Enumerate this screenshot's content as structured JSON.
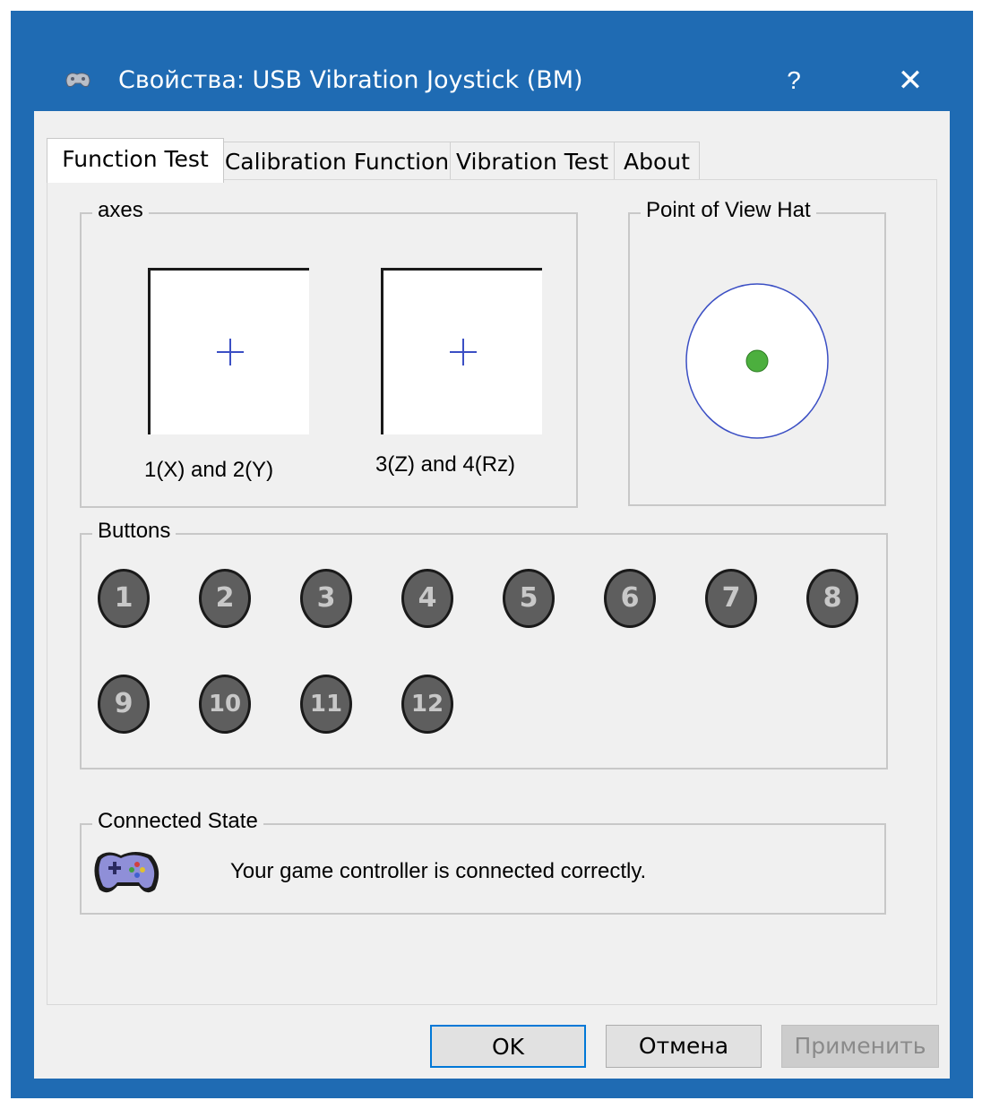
{
  "window": {
    "title": "Свойства: USB Vibration Joystick (BM)",
    "help_glyph": "?",
    "close_glyph": "✕"
  },
  "tabs": [
    {
      "label": "Function Test",
      "active": true
    },
    {
      "label": "Calibration Function",
      "active": false
    },
    {
      "label": "Vibration Test",
      "active": false
    },
    {
      "label": "About",
      "active": false
    }
  ],
  "axes": {
    "group_label": "axes",
    "axis1_label": "1(X) and 2(Y)",
    "axis2_label": "3(Z) and 4(Rz)"
  },
  "pov": {
    "group_label": "Point of View Hat",
    "indicator_color": "#4caf3e"
  },
  "buttons": {
    "group_label": "Buttons",
    "items": [
      "1",
      "2",
      "3",
      "4",
      "5",
      "6",
      "7",
      "8",
      "9",
      "10",
      "11",
      "12"
    ]
  },
  "connected": {
    "group_label": "Connected State",
    "message": "Your game controller is connected correctly."
  },
  "footer": {
    "ok_label": "OK",
    "cancel_label": "Отмена",
    "apply_label": "Применить"
  },
  "colors": {
    "titlebar": "#1f6bb3",
    "crosshair": "#3b4fc4",
    "pov_circle": "#3b4fc4"
  },
  "icons": {
    "title": "gamepad-icon",
    "connected": "gamepad-icon"
  }
}
